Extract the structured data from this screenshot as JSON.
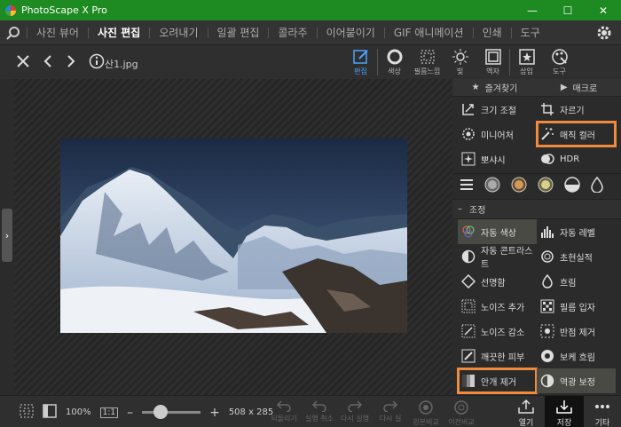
{
  "app": {
    "title": "PhotoScape X Pro"
  },
  "window": {
    "minimize": "—",
    "maximize": "☐",
    "close": "✕"
  },
  "menu": {
    "items": [
      "사진 뷰어",
      "사진 편집",
      "오려내기",
      "일괄 편집",
      "콜라주",
      "이어붙이기",
      "GIF 애니메이션",
      "인쇄",
      "도구"
    ],
    "active_index": 1
  },
  "toolbar": {
    "file_name": "산1.jpg",
    "tabs": [
      "편집",
      "색상",
      "필름느낌",
      "빛",
      "액자",
      "삽입",
      "도구"
    ],
    "active_tab": 0
  },
  "panel": {
    "favorites": "즐겨찾기",
    "macro": "매크로",
    "tools": [
      {
        "label": "크기 조절",
        "icon": "resize-icon"
      },
      {
        "label": "자르기",
        "icon": "crop-icon"
      },
      {
        "label": "미니어처",
        "icon": "miniature-icon"
      },
      {
        "label": "매직 컬러",
        "icon": "magic-wand-icon",
        "highlighted": true
      },
      {
        "label": "뽀샤시",
        "icon": "sparkle-icon"
      },
      {
        "label": "HDR",
        "icon": "hdr-icon"
      }
    ],
    "section_title": "조정",
    "adjust": [
      {
        "label": "자동 색상",
        "icon": "auto-color-icon",
        "selected": true
      },
      {
        "label": "자동 레벨",
        "icon": "auto-level-icon"
      },
      {
        "label": "자동 콘트라스트",
        "icon": "auto-contrast-icon"
      },
      {
        "label": "초현실적",
        "icon": "surreal-icon"
      },
      {
        "label": "선명함",
        "icon": "sharpen-icon"
      },
      {
        "label": "흐림",
        "icon": "blur-icon"
      },
      {
        "label": "노이즈 추가",
        "icon": "add-noise-icon"
      },
      {
        "label": "필름 입자",
        "icon": "film-grain-icon"
      },
      {
        "label": "노이즈 감소",
        "icon": "reduce-noise-icon"
      },
      {
        "label": "반점 제거",
        "icon": "spot-remove-icon"
      },
      {
        "label": "깨끗한 피부",
        "icon": "clean-skin-icon"
      },
      {
        "label": "보케 흐림",
        "icon": "bokeh-icon"
      },
      {
        "label": "안개 제거",
        "icon": "dehaze-icon",
        "highlighted": true
      },
      {
        "label": "역광 보정",
        "icon": "backlight-icon",
        "selected": true
      }
    ]
  },
  "bottom": {
    "zoom": "100%",
    "ratio": "1:1",
    "zoom_level": 0.2,
    "size": "508 x 285",
    "actions": [
      "되돌리기",
      "실행 취소",
      "다시 실행",
      "다시 실",
      "원본비교",
      "이전비교"
    ],
    "open": "열기",
    "save": "저장",
    "more": "기타"
  },
  "colors": {
    "titlebar": "#1e8a22",
    "highlight": "#f08a3c",
    "accent": "#4ea3ff"
  }
}
